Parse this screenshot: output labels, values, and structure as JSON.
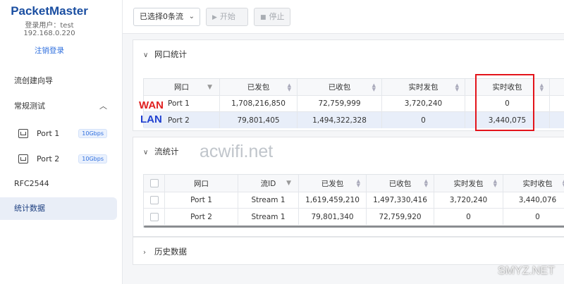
{
  "sidebar": {
    "brand": "PacketMaster",
    "login_user": "登录用户：test",
    "ip": "192.168.0.220",
    "logout": "注销登录",
    "nav": {
      "wizard": "流创建向导",
      "general": "常规测试",
      "ports": [
        {
          "label": "Port 1",
          "speed": "10Gbps"
        },
        {
          "label": "Port 2",
          "speed": "10Gbps"
        }
      ],
      "rfc": "RFC2544",
      "stats": "统计数据"
    }
  },
  "toolbar": {
    "select_label": "已选择0条流",
    "start": "开始",
    "stop": "停止"
  },
  "port_stats": {
    "title": "网口统计",
    "headers": [
      "网口",
      "已发包",
      "已收包",
      "实时发包",
      "实时收包"
    ],
    "rows": [
      {
        "port": "Port 1",
        "tx": "1,708,216,850",
        "rx": "72,759,999",
        "rt_tx": "3,720,240",
        "rt_rx": "0",
        "tag": "WAN"
      },
      {
        "port": "Port 2",
        "tx": "79,801,405",
        "rx": "1,494,322,328",
        "rt_tx": "0",
        "rt_rx": "3,440,075",
        "tag": "LAN"
      }
    ]
  },
  "flow_stats": {
    "title": "流统计",
    "headers": [
      "网口",
      "流ID",
      "已发包",
      "已收包",
      "实时发包",
      "实时收包"
    ],
    "rows": [
      {
        "port": "Port 1",
        "id": "Stream 1",
        "tx": "1,619,459,210",
        "rx": "1,497,330,416",
        "rt_tx": "3,720,240",
        "rt_rx": "3,440,076"
      },
      {
        "port": "Port 2",
        "id": "Stream 1",
        "tx": "79,801,340",
        "rx": "72,759,920",
        "rt_tx": "0",
        "rt_rx": "0"
      }
    ]
  },
  "history": {
    "title": "历史数据"
  },
  "watermarks": {
    "center": "acwifi.net",
    "corner": "SMYZ.NET"
  },
  "colors": {
    "brand": "#1a4ea1",
    "highlight_box": "#e3141b",
    "wan": "#e02020",
    "lan": "#2040d0",
    "active_nav": "#e9eef7"
  }
}
